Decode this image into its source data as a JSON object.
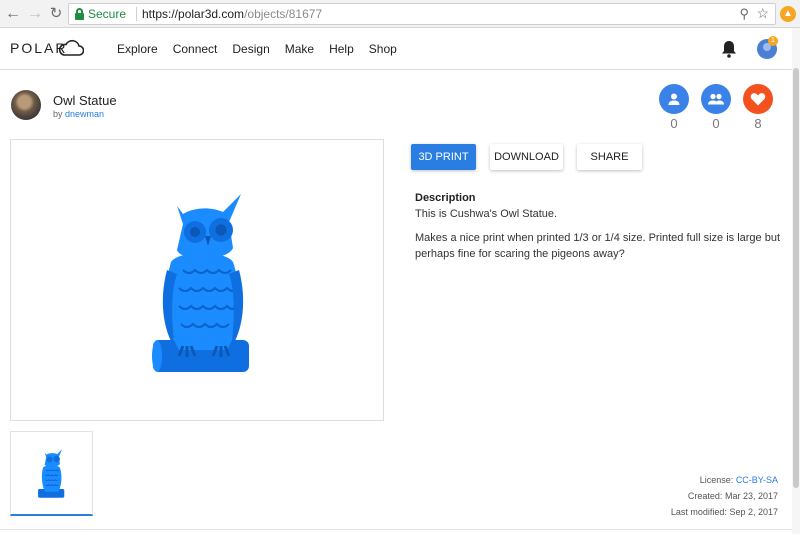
{
  "browser": {
    "secure_label": "Secure",
    "url_host": "https://polar3d.com",
    "url_path": "/objects/81677"
  },
  "header": {
    "logo_text": "POLAR",
    "nav": [
      "Explore",
      "Connect",
      "Design",
      "Make",
      "Help",
      "Shop"
    ],
    "notification_count": "1"
  },
  "object": {
    "title": "Owl Statue",
    "by_label": "by",
    "author": "dnewman",
    "stats": {
      "followers": "0",
      "groups": "0",
      "likes": "8"
    }
  },
  "actions": {
    "print": "3D PRINT",
    "download": "DOWNLOAD",
    "share": "SHARE"
  },
  "description": {
    "heading": "Description",
    "line1": "This is Cushwa's Owl Statue.",
    "body": "Makes a nice print when printed 1/3 or 1/4 size. Printed full size is large but perhaps fine for scaring the pigeons away?"
  },
  "meta": {
    "license_label": "License:",
    "license_value": "CC-BY-SA",
    "created_label": "Created:",
    "created_value": "Mar 23, 2017",
    "modified_label": "Last modified:",
    "modified_value": "Sep 2, 2017"
  },
  "colors": {
    "accent": "#2a7de1",
    "model": "#1a8cff",
    "like": "#f4511e",
    "secure": "#1e8e3e"
  },
  "icons": [
    "back-arrow-icon",
    "forward-arrow-icon",
    "reload-icon",
    "lock-icon",
    "zoom-icon",
    "star-icon",
    "extension-icon",
    "cloud-logo-icon",
    "bell-icon",
    "person-icon",
    "group-icon",
    "heart-icon"
  ]
}
